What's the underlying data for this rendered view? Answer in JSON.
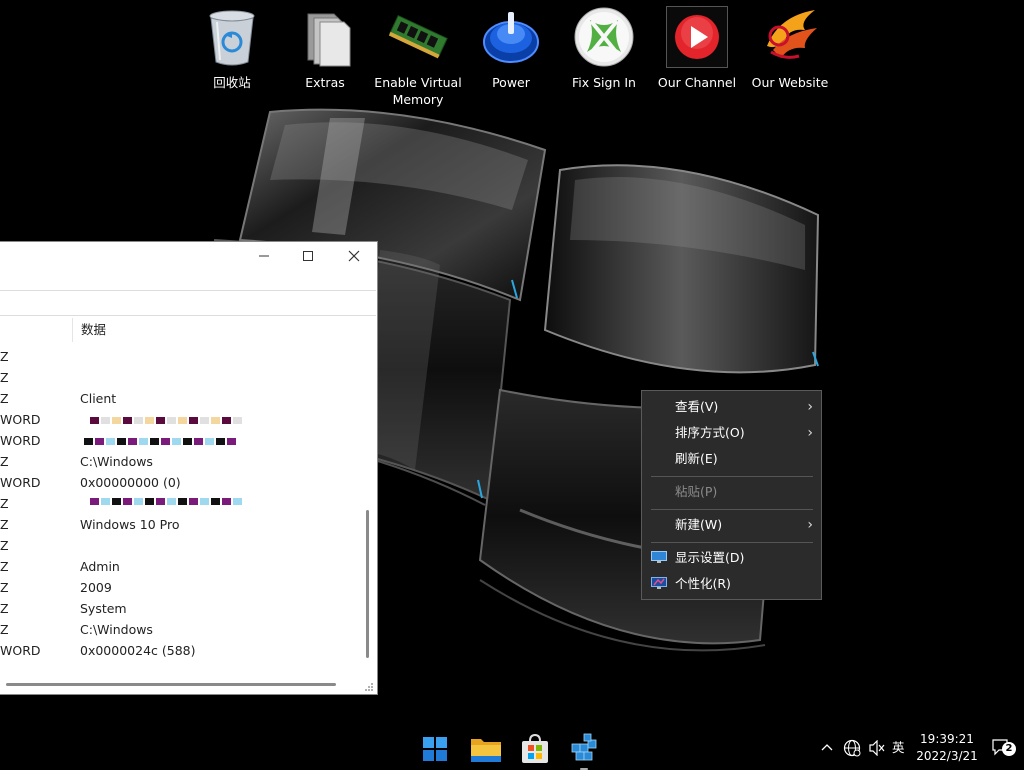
{
  "desktop_icons": [
    {
      "label": "回收站",
      "icon": "recycle-bin-icon"
    },
    {
      "label": "Extras",
      "icon": "folder-icon"
    },
    {
      "label": "Enable Virtual Memory",
      "icon": "memory-module-icon"
    },
    {
      "label": "Power",
      "icon": "power-icon"
    },
    {
      "label": "Fix Sign In",
      "icon": "xbox-icon"
    },
    {
      "label": "Our Channel",
      "icon": "play-icon"
    },
    {
      "label": "Our Website",
      "icon": "phoenix-logo-icon"
    }
  ],
  "regedit": {
    "column_header": "数据",
    "rows": [
      {
        "type": "Z",
        "data": ""
      },
      {
        "type": "Z",
        "data": ""
      },
      {
        "type": "Z",
        "data": "Client"
      },
      {
        "type": "WORD",
        "data": ""
      },
      {
        "type": "WORD",
        "data": ""
      },
      {
        "type": "Z",
        "data": "C:\\Windows"
      },
      {
        "type": "WORD",
        "data": "0x00000000 (0)"
      },
      {
        "type": "Z",
        "data": ""
      },
      {
        "type": "Z",
        "data": "Windows 10 Pro"
      },
      {
        "type": "Z",
        "data": ""
      },
      {
        "type": "Z",
        "data": "Admin"
      },
      {
        "type": "Z",
        "data": "2009"
      },
      {
        "type": "Z",
        "data": "System"
      },
      {
        "type": "Z",
        "data": "C:\\Windows"
      },
      {
        "type": "WORD",
        "data": "0x0000024c (588)"
      }
    ]
  },
  "context_menu": {
    "items": [
      {
        "label": "查看(V)",
        "submenu": true,
        "disabled": false
      },
      {
        "label": "排序方式(O)",
        "submenu": true,
        "disabled": false
      },
      {
        "label": "刷新(E)",
        "submenu": false,
        "disabled": false
      },
      {
        "label": "粘贴(P)",
        "submenu": false,
        "disabled": true
      },
      {
        "label": "新建(W)",
        "submenu": true,
        "disabled": false
      },
      {
        "label": "显示设置(D)",
        "submenu": false,
        "disabled": false,
        "icon": "display-settings-icon"
      },
      {
        "label": "个性化(R)",
        "submenu": false,
        "disabled": false,
        "icon": "personalize-icon"
      }
    ]
  },
  "taskbar": {
    "apps": [
      "start-icon",
      "file-explorer-icon",
      "store-icon",
      "registry-editor-icon"
    ],
    "tray": {
      "ime": "英",
      "time": "19:39:21",
      "date": "2022/3/21",
      "notification_count": "2"
    }
  },
  "colors": {
    "menu_bg": "#2b2b2b",
    "taskbar_bg": "#000000",
    "window_bg": "#ffffff"
  }
}
